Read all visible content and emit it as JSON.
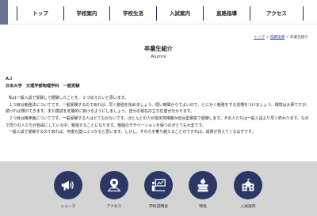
{
  "nav": {
    "items": [
      {
        "label": "トップ"
      },
      {
        "label": "学校案内"
      },
      {
        "label": "学校生活"
      },
      {
        "label": "入試案内"
      },
      {
        "label": "進路指導"
      },
      {
        "label": "アクセス"
      }
    ]
  },
  "breadcrumb": {
    "home": "トップ",
    "sep1": " > ",
    "parent": "進路指導",
    "sep2": " > ",
    "current": "卒業生紹介"
  },
  "page": {
    "title": "卒業生紹介",
    "subtitle": "Alumni"
  },
  "article": {
    "heading": "A.I",
    "affiliation": "日本大学　文理学部物理学科　一般受験",
    "paragraphs": [
      "私は一般入試で受験して経験したことを、２つ伝えたいと思います。",
      "１つ目は勉強法についてです。一般受験するのであれば、早く勉強を始めましょう。短い時間からでよいので、とにかく勉強をする習慣をつけましょう。環境は大事ですが、続ければ慣れてきます。また模試を定期的に受けるようにしましょう。自分の現在の立ち位置が分かります。",
      "２つ目は精神面についてです。一般受験する人はとてもかないです。ほとんどの人が指定校推薦か総合型選抜で受験します。その人たちは一般入試より早く終わります。なので周りの人たちが自由にしている中、勉強することになります。勉強のモチベーションを保つのがとても大変です。",
      "一般入試で受験するのであれば、何度も壁にぶつかると思います。しかし、それらを乗り越えることができれば、成果が見えてくるはずです。"
    ]
  },
  "footer": {
    "items": [
      {
        "label": "ニュース",
        "icon": "megaphone-icon"
      },
      {
        "label": "アクセス",
        "icon": "map-pin-icon"
      },
      {
        "label": "学校説明会",
        "icon": "presentation-icon"
      },
      {
        "label": "特色",
        "icon": "books-apple-icon"
      },
      {
        "label": "入試案内",
        "icon": "school-building-icon"
      }
    ]
  },
  "colors": {
    "navy": "#2c3766",
    "footer_bg": "#d4d4d4",
    "nav_lead": "#6a7391"
  }
}
